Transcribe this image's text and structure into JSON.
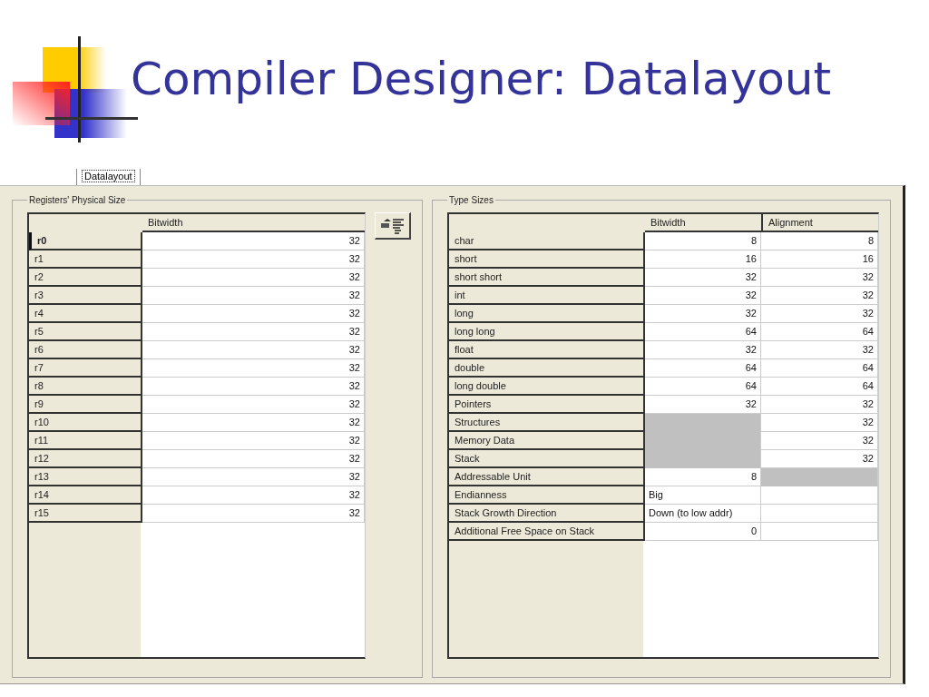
{
  "slide_title": "Compiler Designer: Datalayout",
  "tabs": [
    {
      "label": "Datalayout",
      "selected": true
    }
  ],
  "registers": {
    "legend": "Registers' Physical Size",
    "columns": [
      "Bitwidth"
    ],
    "rows": [
      {
        "name": "r0",
        "bitwidth": "32",
        "selected": true
      },
      {
        "name": "r1",
        "bitwidth": "32",
        "selected": false
      },
      {
        "name": "r2",
        "bitwidth": "32",
        "selected": false
      },
      {
        "name": "r3",
        "bitwidth": "32",
        "selected": false
      },
      {
        "name": "r4",
        "bitwidth": "32",
        "selected": false
      },
      {
        "name": "r5",
        "bitwidth": "32",
        "selected": false
      },
      {
        "name": "r6",
        "bitwidth": "32",
        "selected": false
      },
      {
        "name": "r7",
        "bitwidth": "32",
        "selected": false
      },
      {
        "name": "r8",
        "bitwidth": "32",
        "selected": false
      },
      {
        "name": "r9",
        "bitwidth": "32",
        "selected": false
      },
      {
        "name": "r10",
        "bitwidth": "32",
        "selected": false
      },
      {
        "name": "r11",
        "bitwidth": "32",
        "selected": false
      },
      {
        "name": "r12",
        "bitwidth": "32",
        "selected": false
      },
      {
        "name": "r13",
        "bitwidth": "32",
        "selected": false
      },
      {
        "name": "r14",
        "bitwidth": "32",
        "selected": false
      },
      {
        "name": "r15",
        "bitwidth": "32",
        "selected": false
      }
    ]
  },
  "type_sizes": {
    "legend": "Type Sizes",
    "columns": [
      "Bitwidth",
      "Alignment"
    ],
    "rows": [
      {
        "name": "char",
        "kind": "number",
        "cells": [
          {
            "text": "8",
            "disabled": false
          },
          {
            "text": "8",
            "disabled": false
          }
        ]
      },
      {
        "name": "short",
        "kind": "number",
        "cells": [
          {
            "text": "16",
            "disabled": false
          },
          {
            "text": "16",
            "disabled": false
          }
        ]
      },
      {
        "name": "short short",
        "kind": "number",
        "cells": [
          {
            "text": "32",
            "disabled": false
          },
          {
            "text": "32",
            "disabled": false
          }
        ]
      },
      {
        "name": "int",
        "kind": "number",
        "cells": [
          {
            "text": "32",
            "disabled": false
          },
          {
            "text": "32",
            "disabled": false
          }
        ]
      },
      {
        "name": "long",
        "kind": "number",
        "cells": [
          {
            "text": "32",
            "disabled": false
          },
          {
            "text": "32",
            "disabled": false
          }
        ]
      },
      {
        "name": "long long",
        "kind": "number",
        "cells": [
          {
            "text": "64",
            "disabled": false
          },
          {
            "text": "64",
            "disabled": false
          }
        ]
      },
      {
        "name": "float",
        "kind": "number",
        "cells": [
          {
            "text": "32",
            "disabled": false
          },
          {
            "text": "32",
            "disabled": false
          }
        ]
      },
      {
        "name": "double",
        "kind": "number",
        "cells": [
          {
            "text": "64",
            "disabled": false
          },
          {
            "text": "64",
            "disabled": false
          }
        ]
      },
      {
        "name": "long double",
        "kind": "number",
        "cells": [
          {
            "text": "64",
            "disabled": false
          },
          {
            "text": "64",
            "disabled": false
          }
        ]
      },
      {
        "name": "Pointers",
        "kind": "number",
        "cells": [
          {
            "text": "32",
            "disabled": false
          },
          {
            "text": "32",
            "disabled": false
          }
        ]
      },
      {
        "name": "Structures",
        "kind": "number",
        "cells": [
          {
            "disabled": true
          },
          {
            "text": "32",
            "disabled": false
          }
        ]
      },
      {
        "name": "Memory Data",
        "kind": "number",
        "cells": [
          {
            "disabled": true
          },
          {
            "text": "32",
            "disabled": false
          }
        ]
      },
      {
        "name": "Stack",
        "kind": "number",
        "cells": [
          {
            "disabled": true
          },
          {
            "text": "32",
            "disabled": false
          }
        ]
      },
      {
        "name": "Addressable Unit",
        "kind": "number",
        "cells": [
          {
            "text": "8",
            "disabled": false
          },
          {
            "disabled": true
          }
        ]
      },
      {
        "name": "Endianness",
        "kind": "text",
        "cells": [
          {
            "text": "Big",
            "disabled": false
          },
          {
            "disabled": false
          }
        ]
      },
      {
        "name": "Stack Growth Direction",
        "kind": "text",
        "cells": [
          {
            "text": "Down (to low addr)",
            "disabled": false
          },
          {
            "disabled": false
          }
        ]
      },
      {
        "name": "Additional Free Space on Stack",
        "kind": "number",
        "cells": [
          {
            "text": "0",
            "disabled": false
          },
          {
            "disabled": false
          }
        ]
      }
    ]
  }
}
